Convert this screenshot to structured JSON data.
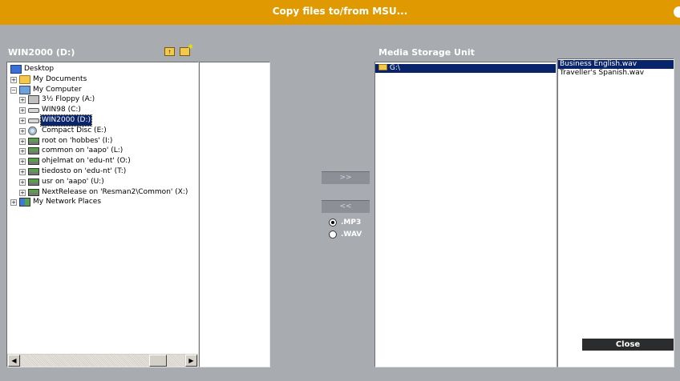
{
  "window": {
    "title": "Copy files to/from MSU..."
  },
  "left": {
    "drive_label": "WIN2000 (D:)",
    "toolbar_icons": [
      "folder-up-icon",
      "new-folder-icon"
    ],
    "tree": [
      {
        "label": "Desktop",
        "icon": "desktop-icon",
        "level": 0,
        "expander": ""
      },
      {
        "label": "My Documents",
        "icon": "folder-icon",
        "level": 1,
        "expander": "+"
      },
      {
        "label": "My Computer",
        "icon": "computer-icon",
        "level": 1,
        "expander": "-"
      },
      {
        "label": "3½ Floppy (A:)",
        "icon": "floppy-icon",
        "level": 2,
        "expander": "+"
      },
      {
        "label": "WIN98 (C:)",
        "icon": "drive-icon",
        "level": 2,
        "expander": "+"
      },
      {
        "label": "WIN2000 (D:)",
        "icon": "drive-icon",
        "level": 2,
        "expander": "+",
        "selected": true
      },
      {
        "label": "Compact Disc (E:)",
        "icon": "cd-icon",
        "level": 2,
        "expander": "+"
      },
      {
        "label": "root on 'hobbes' (I:)",
        "icon": "network-drive-icon",
        "level": 2,
        "expander": "+"
      },
      {
        "label": "common on 'aapo' (L:)",
        "icon": "network-drive-icon",
        "level": 2,
        "expander": "+"
      },
      {
        "label": "ohjelmat on 'edu-nt' (O:)",
        "icon": "network-drive-icon",
        "level": 2,
        "expander": "+"
      },
      {
        "label": "tiedosto on 'edu-nt' (T:)",
        "icon": "network-drive-icon",
        "level": 2,
        "expander": "+"
      },
      {
        "label": "usr on 'aapo' (U:)",
        "icon": "network-drive-icon",
        "level": 2,
        "expander": "+"
      },
      {
        "label": "NextRelease on 'Resman2\\Common' (X:)",
        "icon": "network-drive-icon",
        "level": 2,
        "expander": "+"
      },
      {
        "label": "My Network Places",
        "icon": "network-places-icon",
        "level": 1,
        "expander": "+"
      }
    ]
  },
  "transfer": {
    "copy_to_label": ">>",
    "copy_from_label": "<<",
    "formats": [
      {
        "label": ".MP3",
        "selected": true
      },
      {
        "label": ".WAV",
        "selected": false
      }
    ]
  },
  "right": {
    "title": "Media Storage Unit",
    "folder": {
      "label": "G:\\",
      "icon": "folder-open-icon",
      "selected": true
    },
    "files": [
      {
        "label": "Business English.wav",
        "selected": true
      },
      {
        "label": "Traveller's Spanish.wav",
        "selected": false
      }
    ]
  },
  "close_label": "Close"
}
